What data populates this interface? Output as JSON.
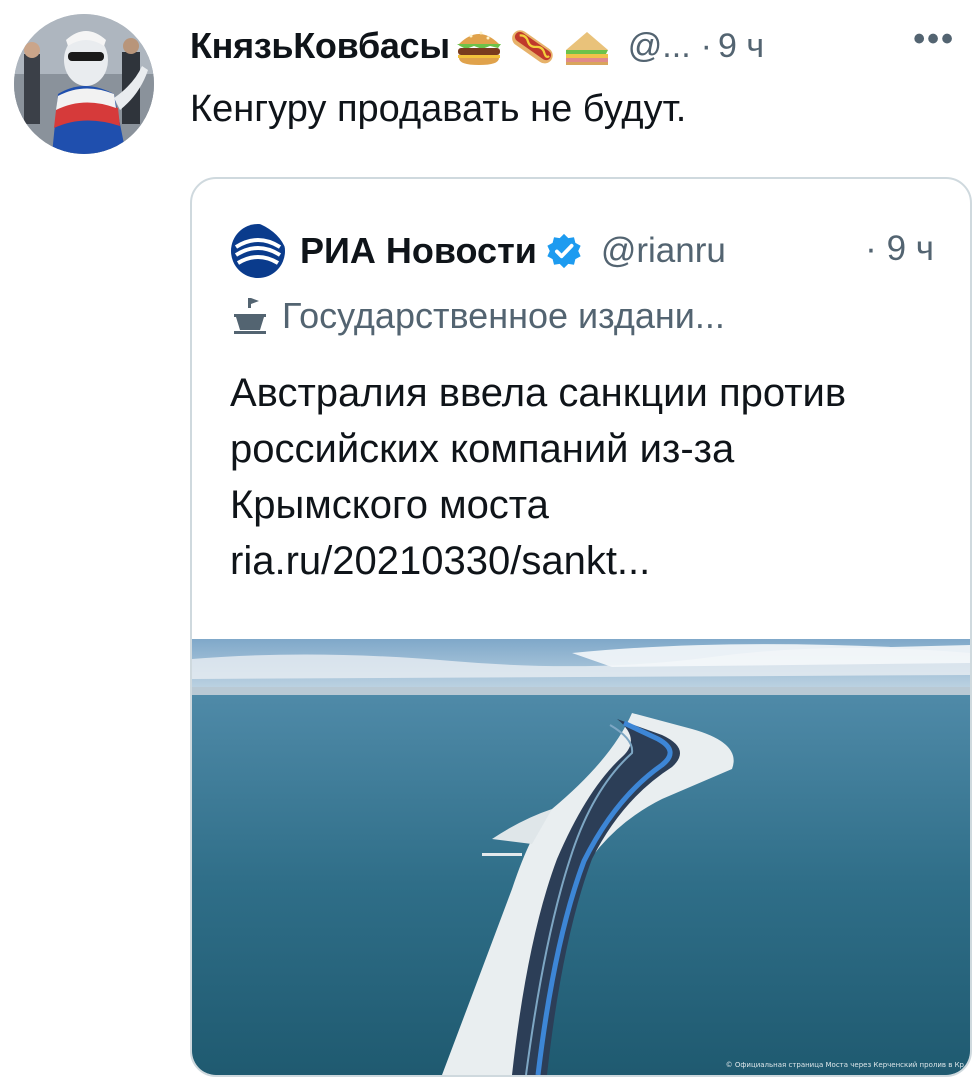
{
  "outer": {
    "display_name": "КнязьКовбасы",
    "emojis": [
      "hamburger-emoji",
      "hotdog-emoji",
      "sandwich-emoji"
    ],
    "handle": "@...",
    "separator": "·",
    "time": "9 ч",
    "more": "•••",
    "text": "Кенгуру продавать не будут."
  },
  "quote": {
    "name": "РИА Новости",
    "handle": "@rianru",
    "separator": "·",
    "time": "9 ч",
    "label": "Государственное издани...",
    "body_lines": [
      "Австралия ввела санкции против",
      "российских компаний из-за",
      "Крымского моста"
    ],
    "link": "ria.ru/20210330/sankt...",
    "media_caption": "© Официальная страница Моста через Керченский пролив в Кр",
    "accent_color": "#1d9bf0",
    "logo_color": "#0a3b8c"
  }
}
